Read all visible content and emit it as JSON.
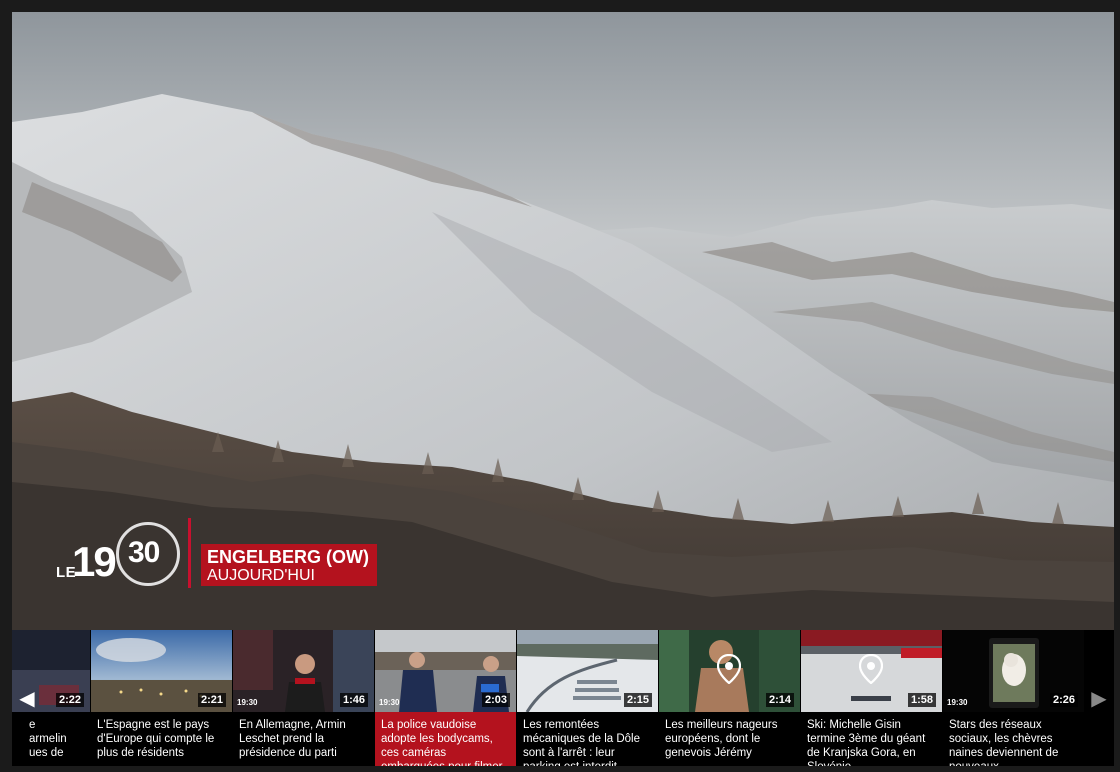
{
  "player": {
    "broadcast": {
      "show_prefix": "LE",
      "show_hour": "19",
      "show_minute": "30"
    },
    "lower_third": {
      "location": "ENGELBERG (OW)",
      "time": "AUJOURD'HUI"
    }
  },
  "playlist": {
    "prev_icon": "◀",
    "next_icon": "▶",
    "items": [
      {
        "title": "le Carmelin ques de",
        "title_lines": [
          "e",
          "armelin",
          "ues de"
        ],
        "duration": "2:22",
        "active": false
      },
      {
        "title": "L'Espagne est le pays d'Europe qui compte le plus de résidents",
        "duration": "2:21",
        "active": false
      },
      {
        "title": "En Allemagne, Armin Leschet prend la présidence du parti",
        "duration": "1:46",
        "active": false
      },
      {
        "title": "La police vaudoise adopte les bodycams, ces caméras embarquées pour filmer",
        "duration": "2:03",
        "active": true
      },
      {
        "title": "Les remontées mécaniques de la Dôle sont à l'arrêt : leur parking est interdit",
        "duration": "2:15",
        "active": false
      },
      {
        "title": "Les meilleurs nageurs européens, dont le genevois Jérémy",
        "duration": "2:14",
        "active": false
      },
      {
        "title": "Ski: Michelle Gisin termine 3ème du géant de Kranjska Gora, en Slovénie",
        "duration": "1:58",
        "active": false
      },
      {
        "title": "Stars des réseaux sociaux, les chèvres naines deviennent de nouveaux",
        "duration": "2:26",
        "active": false
      }
    ],
    "mini_logo": "19:30"
  },
  "colors": {
    "accent_red": "#b4121e",
    "background": "#1b1b1b"
  }
}
